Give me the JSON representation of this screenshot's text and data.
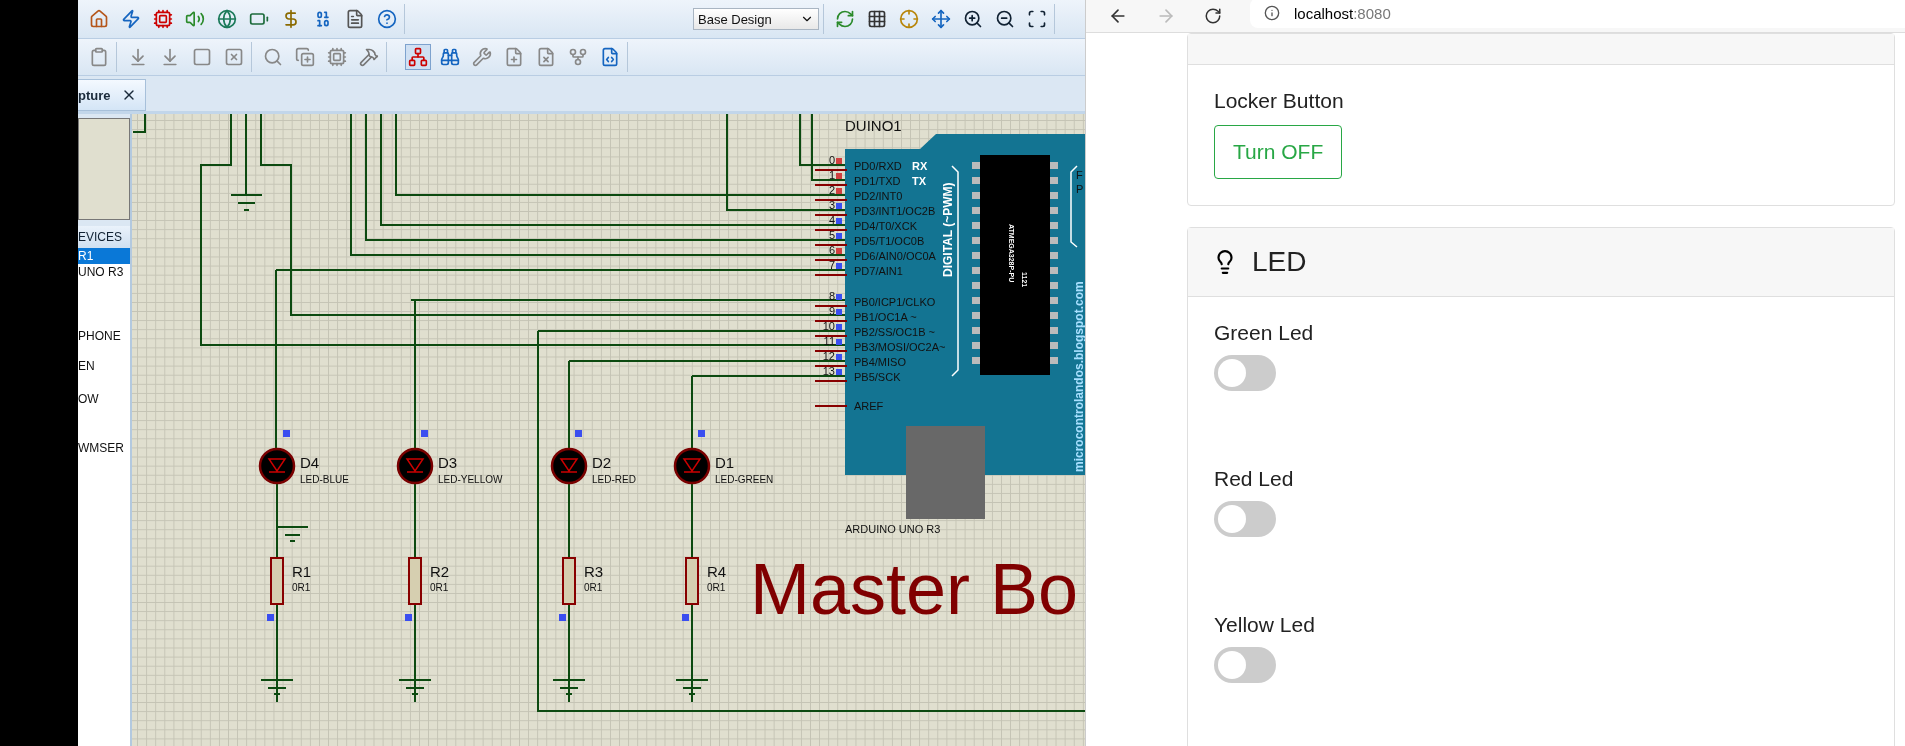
{
  "toolbar": {
    "design_dropdown": "Base Design"
  },
  "tabs": [
    {
      "label": "pture",
      "selected": true
    }
  ],
  "devices_panel": {
    "title": "EVICES",
    "items": [
      {
        "label": "R1",
        "selected": true
      },
      {
        "label": "UNO R3",
        "selected": false
      },
      {
        "label": "PHONE",
        "selected": false
      },
      {
        "label": "EN",
        "selected": false
      },
      {
        "label": "OW",
        "selected": false
      },
      {
        "label": "WMSER",
        "selected": false
      }
    ]
  },
  "schematic": {
    "board": {
      "name": "DUINO1",
      "part": "ARDUINO UNO R3",
      "chip": "ATMEGA328P-PU",
      "chip_code": "1121",
      "header_label": "DIGITAL (~PWM)",
      "rx": "RX",
      "tx": "TX",
      "aref": "AREF",
      "side_letters": [
        "F",
        "P"
      ],
      "vertical_text": "microcontrolandos.blogspot.com",
      "pins": [
        {
          "number": "0",
          "label": "PD0/RXD",
          "color": "#d04040"
        },
        {
          "number": "1",
          "label": "PD1/TXD",
          "color": "#d04040"
        },
        {
          "number": "2",
          "label": "PD2/INT0",
          "color": "#d04040"
        },
        {
          "number": "3",
          "label": "PD3/INT1/OC2B",
          "color": "#3a4ef0"
        },
        {
          "number": "4",
          "label": "PD4/T0/XCK",
          "color": "#3a4ef0"
        },
        {
          "number": "5",
          "label": "PD5/T1/OC0B",
          "color": "#3a4ef0"
        },
        {
          "number": "6",
          "label": "PD6/AIN0/OC0A",
          "color": "#d04040"
        },
        {
          "number": "7",
          "label": "PD7/AIN1",
          "color": "#3a4ef0"
        },
        {
          "number": "8",
          "label": "PB0/ICP1/CLKO",
          "color": "#3a4ef0"
        },
        {
          "number": "9",
          "label": "PB1/OC1A ~",
          "color": "#3a4ef0"
        },
        {
          "number": "10",
          "label": "PB2/SS/OC1B ~",
          "color": "#3a4ef0"
        },
        {
          "number": "11",
          "label": "PB3/MOSI/OC2A~",
          "color": "#3a4ef0"
        },
        {
          "number": "12",
          "label": "PB4/MISO",
          "color": "#3a4ef0"
        },
        {
          "number": "13",
          "label": "PB5/SCK",
          "color": "#3a4ef0"
        }
      ]
    },
    "leds": [
      {
        "ref": "D4",
        "type": "LED-BLUE"
      },
      {
        "ref": "D3",
        "type": "LED-YELLOW"
      },
      {
        "ref": "D2",
        "type": "LED-RED"
      },
      {
        "ref": "D1",
        "type": "LED-GREEN"
      }
    ],
    "resistors": [
      {
        "ref": "R1",
        "value": "0R1"
      },
      {
        "ref": "R2",
        "value": "0R1"
      },
      {
        "ref": "R3",
        "value": "0R1"
      },
      {
        "ref": "R4",
        "value": "0R1"
      }
    ],
    "title_text": "Master Bo"
  },
  "browser": {
    "url_host": "localhost",
    "url_port": ":8080"
  },
  "cards": [
    {
      "kind": "locker",
      "label": "Locker Button",
      "button": "Turn OFF"
    },
    {
      "kind": "led",
      "title": "LED",
      "switches": [
        {
          "label": "Green Led",
          "on": false
        },
        {
          "label": "Red Led",
          "on": false
        },
        {
          "label": "Yellow Led",
          "on": false
        }
      ]
    }
  ]
}
